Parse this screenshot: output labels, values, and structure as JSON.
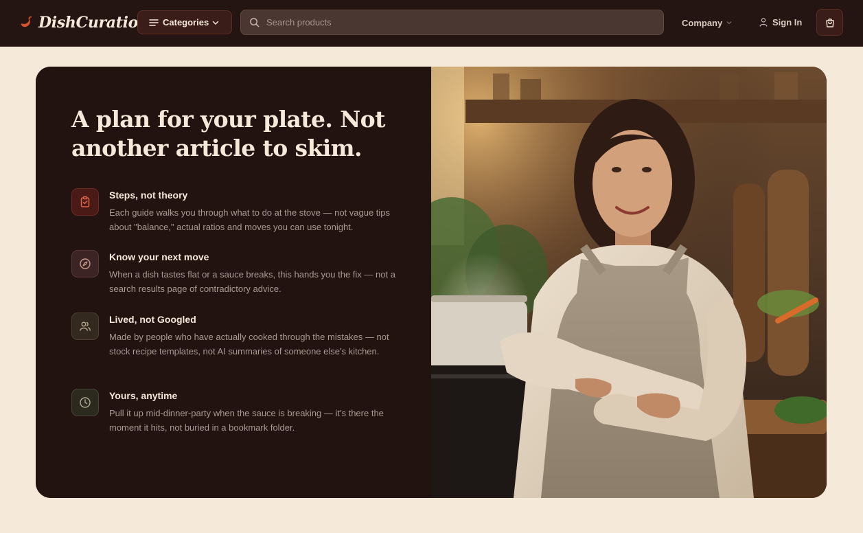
{
  "header": {
    "brand": "DishCuration",
    "categories_label": "Categories",
    "search_placeholder": "Search products",
    "company_label": "Company",
    "signin_label": "Sign In"
  },
  "hero": {
    "headline": "A plan for your plate. Not another article to skim.",
    "features": [
      {
        "icon": "clipboard-check-icon",
        "title": "Steps, not theory",
        "description": "Each guide walks you through what to do at the stove — not vague tips about \"balance,\" actual ratios and moves you can use tonight."
      },
      {
        "icon": "compass-icon",
        "title": "Know your next move",
        "description": "When a dish tastes flat or a sauce breaks, this hands you the fix — not a search results page of contradictory advice."
      },
      {
        "icon": "users-icon",
        "title": "Lived, not Googled",
        "description": "Made by people who have actually cooked through the mistakes — not stock recipe templates, not AI summaries of someone else's kitchen."
      },
      {
        "icon": "clock-icon",
        "title": "Yours, anytime",
        "description": "Pull it up mid-dinner-party when the sauce is breaking — it's there the moment it hits, not buried in a bookmark folder."
      }
    ]
  },
  "colors": {
    "header_bg": "#251512",
    "page_bg": "#f5e9da",
    "card_bg": "#221310",
    "accent": "#d4542f",
    "text_light": "#f5e9da",
    "text_muted": "#a99a92"
  }
}
